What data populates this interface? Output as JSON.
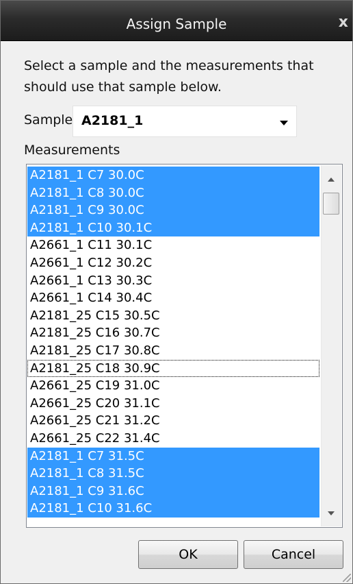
{
  "window": {
    "title": "Assign Sample",
    "close_glyph": "x"
  },
  "instructions": {
    "line1": "Select a sample and the measurements that",
    "line2": "should use that sample below."
  },
  "sample": {
    "label": "Sample",
    "value": "A2181_1"
  },
  "measurements": {
    "label": "Measurements",
    "items": [
      {
        "text": "A2181_1 C7 30.0C",
        "selected": true,
        "focused": false
      },
      {
        "text": "A2181_1 C8 30.0C",
        "selected": true,
        "focused": false
      },
      {
        "text": "A2181_1 C9 30.0C",
        "selected": true,
        "focused": false
      },
      {
        "text": "A2181_1 C10 30.1C",
        "selected": true,
        "focused": false
      },
      {
        "text": "A2661_1 C11 30.1C",
        "selected": false,
        "focused": false
      },
      {
        "text": "A2661_1 C12 30.2C",
        "selected": false,
        "focused": false
      },
      {
        "text": "A2661_1 C13 30.3C",
        "selected": false,
        "focused": false
      },
      {
        "text": "A2661_1 C14 30.4C",
        "selected": false,
        "focused": false
      },
      {
        "text": "A2181_25 C15 30.5C",
        "selected": false,
        "focused": false
      },
      {
        "text": "A2181_25 C16 30.7C",
        "selected": false,
        "focused": false
      },
      {
        "text": "A2181_25 C17 30.8C",
        "selected": false,
        "focused": false
      },
      {
        "text": "A2181_25 C18 30.9C",
        "selected": false,
        "focused": true
      },
      {
        "text": "A2661_25 C19 31.0C",
        "selected": false,
        "focused": false
      },
      {
        "text": "A2661_25 C20 31.1C",
        "selected": false,
        "focused": false
      },
      {
        "text": "A2661_25 C21 31.2C",
        "selected": false,
        "focused": false
      },
      {
        "text": "A2661_25 C22 31.4C",
        "selected": false,
        "focused": false
      },
      {
        "text": "A2181_1 C7 31.5C",
        "selected": true,
        "focused": false
      },
      {
        "text": "A2181_1 C8 31.5C",
        "selected": true,
        "focused": false
      },
      {
        "text": "A2181_1 C9 31.6C",
        "selected": true,
        "focused": false
      },
      {
        "text": "A2181_1 C10 31.6C",
        "selected": true,
        "focused": false
      }
    ]
  },
  "buttons": {
    "ok": "OK",
    "cancel": "Cancel"
  },
  "colors": {
    "selection": "#3399ff",
    "titlebar": "#2b2b2b"
  }
}
